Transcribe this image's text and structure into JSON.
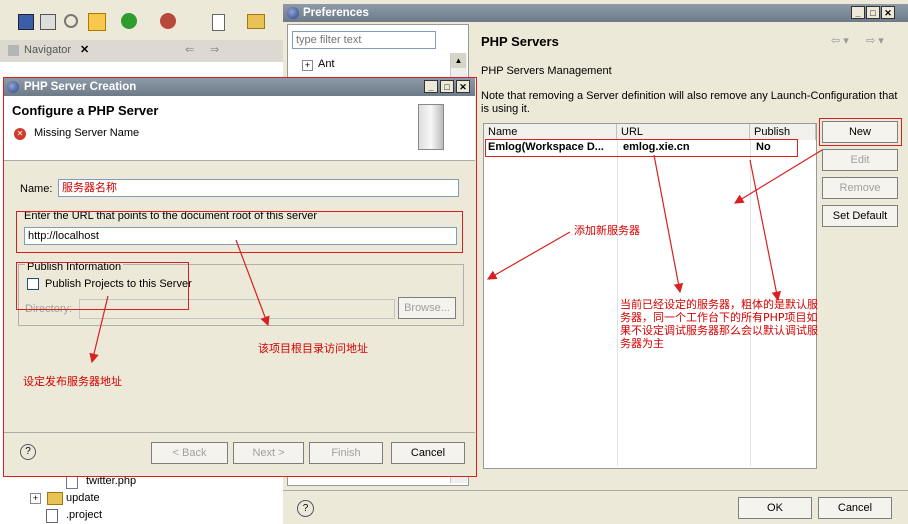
{
  "navigator": {
    "title": "Navigator",
    "tree": [
      "twitter.php",
      "update",
      ".project"
    ]
  },
  "prefs": {
    "title": "Preferences",
    "filter_placeholder": "type filter text",
    "tree_item": "Ant",
    "page_title": "PHP Servers",
    "section": "PHP Servers Management",
    "note": "Note that removing a Server definition will also remove any Launch-Configuration that is using it.",
    "columns": [
      "Name",
      "URL",
      "Publish"
    ],
    "row": {
      "name": "Emlog(Workspace D...",
      "url": "emlog.xie.cn",
      "publish": "No"
    },
    "buttons": {
      "new": "New",
      "edit": "Edit",
      "remove": "Remove",
      "set_default": "Set Default"
    },
    "ok": "OK",
    "cancel": "Cancel"
  },
  "dialog": {
    "title": "PHP Server Creation",
    "heading": "Configure a PHP Server",
    "error": "Missing Server Name",
    "name_label": "Name:",
    "name_value": "服务器名称",
    "url_label": "Enter the URL that points to the document root of this server",
    "url_value": "http://localhost",
    "publish_group": "Publish Information",
    "publish_checkbox": "Publish Projects to this Server",
    "directory_label": "Directory:",
    "browse": "Browse...",
    "back": "< Back",
    "next": "Next >",
    "finish": "Finish",
    "cancel": "Cancel"
  },
  "annotations": {
    "add_server": "添加新服务器",
    "root_url": "该项目根目录访问地址",
    "publish_addr": "设定发布服务器地址",
    "current_server": "当前已经设定的服务器，粗体的是默认服务器，同一个工作台下的所有PHP项目如果不设定调试服务器那么会以默认调试服务器为主"
  },
  "colors": {
    "annotation_red": "#d82020",
    "title_bar": "#7b8794"
  }
}
